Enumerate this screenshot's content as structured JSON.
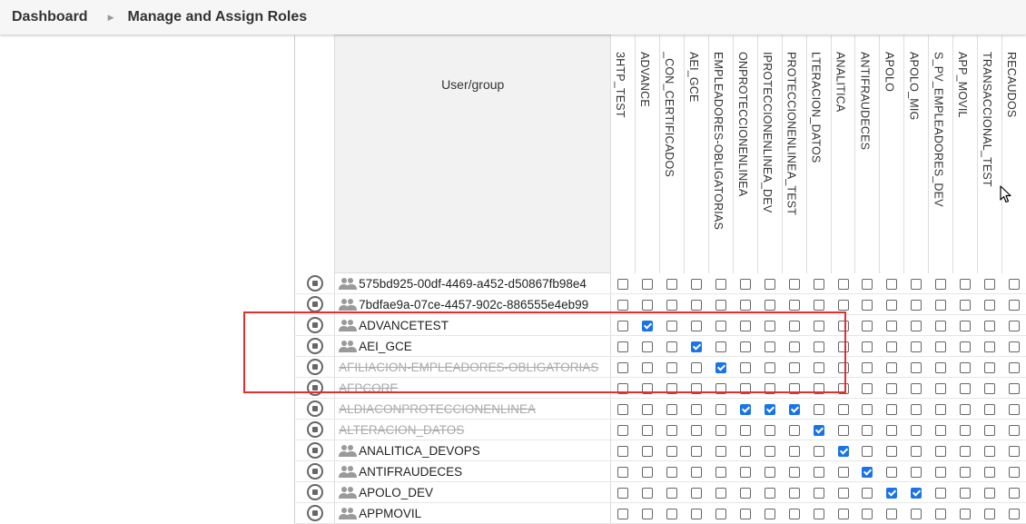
{
  "header": {
    "crumbs": [
      "Dashboard",
      "Manage and Assign Roles"
    ]
  },
  "table": {
    "user_header": "User/group",
    "roles": [
      "3HTP_TEST",
      "ADVANCE",
      "_CON_CERTIFICADOS",
      "AEI_GCE",
      "EMPLEADORES-OBLIGATORIAS",
      "ONPROTECCIONENLINEA",
      "IPROTECCIONENLINEA_DEV",
      "PROTECCIONENLINEA_TEST",
      "LTERACION_DATOS",
      "ANALITICA",
      "ANTIFRAUDECES",
      "APOLO",
      "APOLO_MIG",
      "S_PV_EMPLEADORES_DEV",
      "APP_MOVIL",
      "TRANSACCIONAL_TEST",
      "RECAUDOS"
    ],
    "rows": [
      {
        "name": "575bd925-00df-4469-a452-d50867fb98e4",
        "type": "group",
        "strike": false,
        "checked": []
      },
      {
        "name": "7bdfae9a-07ce-4457-902c-886555e4eb99",
        "type": "group",
        "strike": false,
        "checked": []
      },
      {
        "name": "ADVANCETEST",
        "type": "group",
        "strike": false,
        "checked": [
          1
        ]
      },
      {
        "name": "AEI_GCE",
        "type": "group",
        "strike": false,
        "checked": [
          3
        ]
      },
      {
        "name": "AFILIACION-EMPLEADORES-OBLIGATORIAS",
        "type": "user",
        "strike": true,
        "checked": [
          4
        ]
      },
      {
        "name": "AFPCORE",
        "type": "user",
        "strike": true,
        "checked": []
      },
      {
        "name": "ALDIACONPROTECCIONENLINEA",
        "type": "user",
        "strike": true,
        "checked": [
          5,
          6,
          7
        ]
      },
      {
        "name": "ALTERACION_DATOS",
        "type": "user",
        "strike": true,
        "checked": [
          8
        ]
      },
      {
        "name": "ANALITICA_DEVOPS",
        "type": "group",
        "strike": false,
        "checked": [
          9
        ]
      },
      {
        "name": "ANTIFRAUDECES",
        "type": "group",
        "strike": false,
        "checked": [
          10
        ]
      },
      {
        "name": "APOLO_DEV",
        "type": "group",
        "strike": false,
        "checked": [
          11,
          12
        ]
      },
      {
        "name": "APPMOVIL",
        "type": "group",
        "strike": false,
        "checked": []
      }
    ]
  },
  "icons": {
    "group": "group-icon",
    "delete": "delete-icon",
    "cursor": "mouse-pointer-icon"
  },
  "colors": {
    "checked": "#1a73e8",
    "highlight": "#e03030",
    "strike_text": "#aaaaaa"
  }
}
